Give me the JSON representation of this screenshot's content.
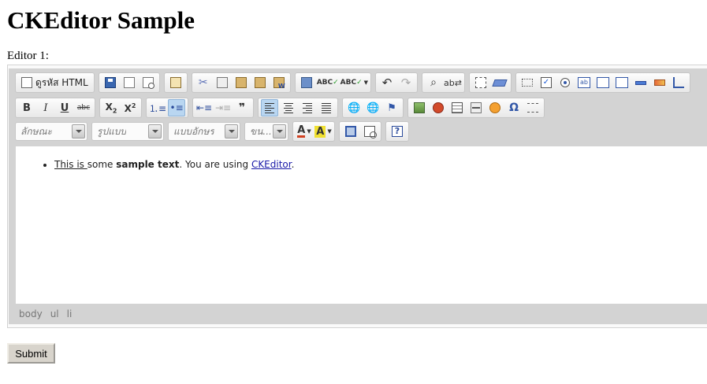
{
  "page": {
    "title": "CKEditor Sample"
  },
  "editor": {
    "label": "Editor 1:"
  },
  "toolbar": {
    "source_label": "ดูรหัส HTML",
    "combos": [
      {
        "label": "ลักษณะ"
      },
      {
        "label": "รูปแบบ"
      },
      {
        "label": "แบบอักษร"
      },
      {
        "label": "ขน..."
      }
    ],
    "active_buttons": [
      "bulleted-list-button",
      "align-left-button"
    ]
  },
  "content": {
    "parts": [
      {
        "text": "This is ",
        "style": "underline"
      },
      {
        "text": "some ",
        "style": "normal"
      },
      {
        "text": "sample text",
        "style": "bold"
      },
      {
        "text": ". You are using ",
        "style": "normal"
      },
      {
        "text": "CKEditor",
        "style": "link"
      },
      {
        "text": ".",
        "style": "normal"
      }
    ]
  },
  "statusbar": {
    "path": [
      "body",
      "ul",
      "li"
    ]
  },
  "form": {
    "submit_label": "Submit"
  },
  "colors": {
    "toolbar_bg": "#d3d3d3",
    "active_button": "#b9d6f1",
    "link": "#1a1aa8"
  }
}
